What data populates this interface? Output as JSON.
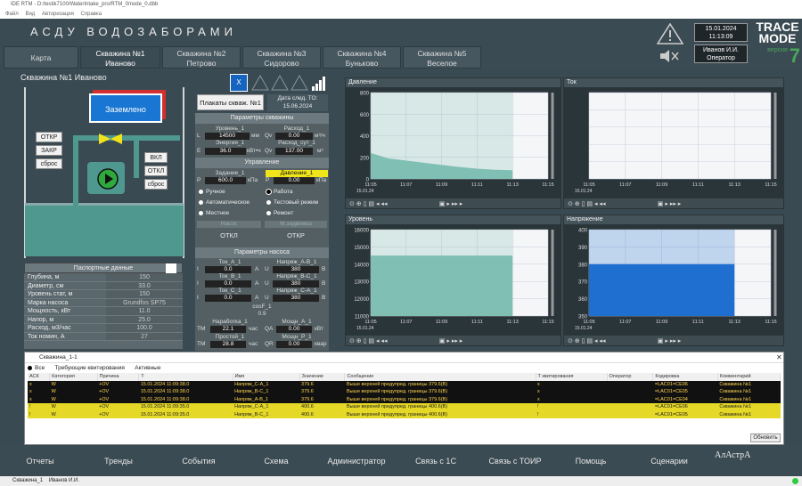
{
  "window": {
    "title": "IDE RTM - D:/testik7100/WaterIntake_pro/RTM_0/node_0.dbb",
    "menu": [
      "Файл",
      "Вид",
      "Авторизация",
      "Справка"
    ]
  },
  "header": {
    "app_title": "АСДУ ВОДОЗАБОРАМИ",
    "tabs": [
      {
        "l1": "",
        "l2": "Карта"
      },
      {
        "l1": "Скважина №1",
        "l2": "Иваново"
      },
      {
        "l1": "Скважина №2",
        "l2": "Петрово"
      },
      {
        "l1": "Скважина №3",
        "l2": "Сидорово"
      },
      {
        "l1": "Скважина №4",
        "l2": "Буньково"
      },
      {
        "l1": "Скважина №5",
        "l2": "Веселое"
      }
    ],
    "date": "15.01.2024",
    "time": "11:13:09",
    "user": "Иванов И.И.",
    "role": "Оператор",
    "logo_l1": "TRACE",
    "logo_l2": "MODE",
    "logo_ver": "версия",
    "logo_num": "7"
  },
  "well": {
    "title": "Скважина №1 Иваново",
    "grounded": "Заземлено",
    "btn_open": "ОТКР",
    "btn_close": "ЗАКР",
    "btn_reset": "сброс",
    "btn_on": "ВКЛ",
    "btn_off": "ОТКЛ",
    "btn_reset2": "сброс"
  },
  "pasport": {
    "title": "Паспортные данные",
    "rows": [
      {
        "k": "Глубина, м",
        "v": "150"
      },
      {
        "k": "Диаметр, см",
        "v": "33.0"
      },
      {
        "k": "Уровень стат, м",
        "v": "150"
      },
      {
        "k": "Марка насоса",
        "v": "Grundfos SP75"
      },
      {
        "k": "Мощность, кВт",
        "v": "11.0"
      },
      {
        "k": "Напор, м",
        "v": "25.0"
      },
      {
        "k": "Расход, м3/час",
        "v": "100.0"
      },
      {
        "k": "Ток номин, А",
        "v": "27"
      }
    ]
  },
  "panel": {
    "x_btn": "X",
    "plakaty": "Плакаты скваж. №1",
    "next_to_label": "Дата след. ТО:",
    "next_to": "15.06.2024",
    "well_params": "Параметры скважины",
    "level_l": "Уровень_1",
    "level_p": "L",
    "level_v": "14500",
    "level_u": "мм",
    "energy_l": "Энергия_1",
    "energy_p": "E",
    "energy_v": "36.0",
    "energy_u": "кВт•ч",
    "flow_l": "Расход_1",
    "flow_p": "Qv",
    "flow_v": "0.00",
    "flow_u": "м³/ч",
    "flowd_l": "Расход_сут_1",
    "flowd_p": "Qv",
    "flowd_v": "137.00",
    "flowd_u": "м³",
    "control": "Управление",
    "task_l": "Задание_1",
    "task_p": "P",
    "task_v": "600.0",
    "task_u": "кПа",
    "press_l": "Давление_1",
    "press_p": "P",
    "press_v": "0.00",
    "press_u": "кПа",
    "m_manual": "Ручное",
    "m_auto": "Автоматическое",
    "m_local": "Местное",
    "r_work": "Работа",
    "r_test": "Тестовый режим",
    "r_repair": "Ремонт",
    "pump": "Насос",
    "valve": "М.задвижка",
    "off": "ОТКЛ",
    "open": "ОТКР",
    "pump_params": "Параметры насоса",
    "ta_l": "Ток_А_1",
    "ta_p": "I",
    "ta_v": "0.0",
    "ta_u": "А",
    "tb_l": "Ток_В_1",
    "tb_p": "I",
    "tb_v": "0.0",
    "tb_u": "А",
    "tc_l": "Ток_С_1",
    "tc_p": "I",
    "tc_v": "0.0",
    "tc_u": "А",
    "uab_l": "Напряж_А-В_1",
    "uab_p": "U",
    "uab_v": "380",
    "uab_u": "В",
    "ubc_l": "Напряж_В-С_1",
    "ubc_p": "U",
    "ubc_v": "380",
    "ubc_u": "В",
    "uca_l": "Напряж_С-А_1",
    "uca_p": "U",
    "uca_v": "380",
    "uca_u": "В",
    "cos_l": "cosF_1",
    "cos_v": "0.9",
    "work_l": "Наработка_1",
    "work_p": "TM",
    "work_v": "22.1",
    "work_u": "час",
    "pa_l": "Мощн_А_1",
    "pa_p": "QA",
    "pa_v": "0.00",
    "pa_u": "кВт",
    "idle_l": "Простой_1",
    "idle_p": "TM",
    "idle_v": "28.8",
    "idle_u": "час",
    "pr_l": "Мощн_Р_1",
    "pr_p": "QR",
    "pr_v": "0.00",
    "pr_u": "квар"
  },
  "charts": [
    {
      "title": "Давление",
      "yticks": [
        "800",
        "600",
        "400",
        "200",
        "0"
      ],
      "xticks": [
        "11:05",
        "11:07",
        "11:09",
        "11:11",
        "11:13",
        "11:15"
      ],
      "date": "15.01.24"
    },
    {
      "title": "Ток",
      "yticks": [
        "",
        "",
        "",
        "",
        "",
        ""
      ],
      "xticks": [
        "11:05",
        "11:07",
        "11:09",
        "11:11",
        "11:13",
        "11:15"
      ],
      "date": "15.01.24"
    },
    {
      "title": "Уровень",
      "yticks": [
        "16000",
        "15000",
        "14000",
        "13000",
        "12000",
        "11000"
      ],
      "xticks": [
        "11:05",
        "11:07",
        "11:09",
        "11:11",
        "11:13",
        "11:15"
      ],
      "date": "15.01.24"
    },
    {
      "title": "Напряжение",
      "yticks": [
        "400",
        "390",
        "380",
        "370",
        "360",
        "350"
      ],
      "xticks": [
        "11:05",
        "11:07",
        "11:09",
        "11:11",
        "11:13",
        "11:15"
      ],
      "date": "15.01.24"
    }
  ],
  "chart_data": [
    {
      "type": "area",
      "title": "Давление",
      "x": [
        "11:05",
        "11:06",
        "11:07",
        "11:08",
        "11:09",
        "11:10",
        "11:11",
        "11:12",
        "11:13"
      ],
      "values": [
        240,
        190,
        170,
        150,
        130,
        110,
        95,
        85,
        80
      ],
      "ylim": [
        0,
        800
      ]
    },
    {
      "type": "line",
      "title": "Ток",
      "x": [
        "11:05",
        "11:13"
      ],
      "values": [
        0,
        0
      ]
    },
    {
      "type": "area",
      "title": "Уровень",
      "x": [
        "11:05",
        "11:13"
      ],
      "values": [
        14500,
        14500
      ],
      "ylim": [
        11000,
        16000
      ]
    },
    {
      "type": "area",
      "title": "Напряжение",
      "x": [
        "11:05",
        "11:13"
      ],
      "values": [
        380,
        380
      ],
      "ylim": [
        350,
        400
      ]
    }
  ],
  "alarms": {
    "title": "Скважина_1-1",
    "f_all": "Все",
    "f_ack": "Требующие квитирования",
    "f_active": "Активные",
    "cols": [
      "АСК",
      "Категория",
      "Причина",
      "Т",
      "Имя",
      "Значение",
      "Сообщение",
      "Т квитирования",
      "Оператор",
      "Кодировка",
      "Комментарий"
    ],
    "rows": [
      {
        "a": "х",
        "c": "W",
        "r": "+OV",
        "t": "15.01.2024 11:09:38.0",
        "n": "Напряж_С-А_1",
        "v": "379.6",
        "m": "Выше верхней предупред. границы 379.6(В)",
        "tk": "х",
        "o": "",
        "k": "=LAC01=CE06",
        "cm": "Скважина №1",
        "s": "blk"
      },
      {
        "a": "х",
        "c": "W",
        "r": "+OV",
        "t": "15.01.2024 11:09:38.0",
        "n": "Напряж_В-С_1",
        "v": "379.6",
        "m": "Выше верхней предупред. границы 379.6(В)",
        "tk": "х",
        "o": "",
        "k": "=LAC01=CE05",
        "cm": "Скважина №1",
        "s": "blk"
      },
      {
        "a": "х",
        "c": "W",
        "r": "+OV",
        "t": "15.01.2024 11:09:38.0",
        "n": "Напряж_А-В_1",
        "v": "379.6",
        "m": "Выше верхней предупред. границы 379.6(В)",
        "tk": "х",
        "o": "",
        "k": "=LAC01=CE04",
        "cm": "Скважина №1",
        "s": "blk"
      },
      {
        "a": "!",
        "c": "W",
        "r": "+OV",
        "t": "15.01.2024 11:09:35.0",
        "n": "Напряж_С-А_1",
        "v": "400.6",
        "m": "Выше верхней предупред. границы 400.6(В)",
        "tk": "!",
        "o": "",
        "k": "=LAC01=CE06",
        "cm": "Скважина №1",
        "s": "yel"
      },
      {
        "a": "!",
        "c": "W",
        "r": "+OV",
        "t": "15.01.2024 11:09:35.0",
        "n": "Напряж_В-С_1",
        "v": "400.6",
        "m": "Выше верхней предупред. границы 400.6(В)",
        "tk": "!",
        "o": "",
        "k": "=LAC01=CE05",
        "cm": "Скважина №1",
        "s": "yel"
      }
    ],
    "refresh": "Обновить"
  },
  "bottom": [
    "Отчеты",
    "Тренды",
    "События",
    "Схема",
    "Администратор",
    "Связь с 1С",
    "Связь с ТОИР",
    "Помощь",
    "Сценарии"
  ],
  "bottom_logo": "АлАстрА",
  "status": {
    "node": "Скважина_1",
    "user": "Иванов И.И."
  },
  "colors": {
    "bg": "#3a4a52",
    "water": "#4e9890",
    "grounded": "#1976d2",
    "alarm_yellow": "#e5d826",
    "plot_fill": "#1e6fd0"
  }
}
